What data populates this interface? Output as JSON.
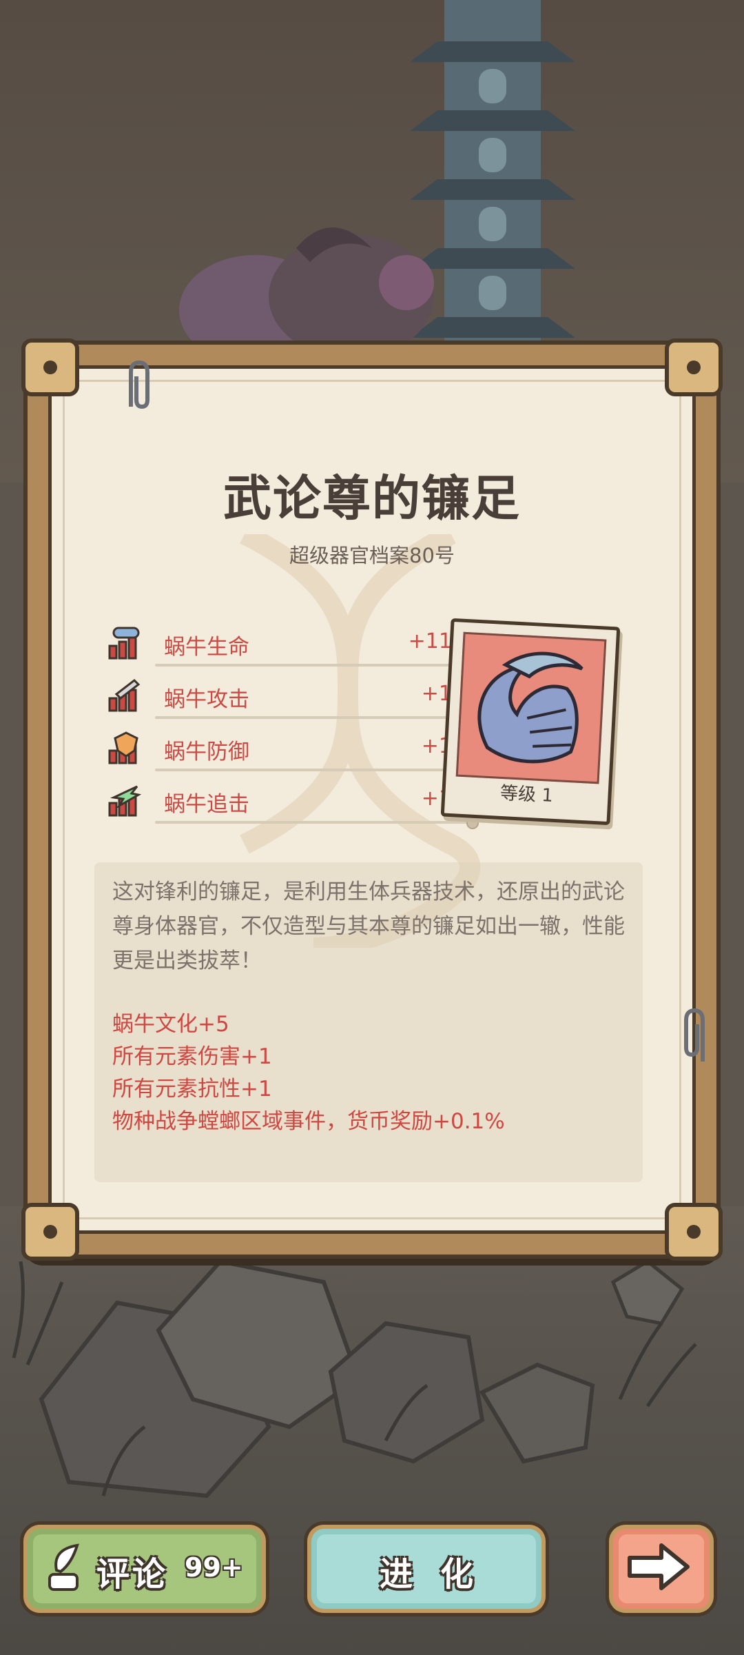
{
  "card": {
    "title": "武论尊的镰足",
    "subtitle": "超级器官档案80号",
    "level_text": "等级 1",
    "stats": [
      {
        "label": "蜗牛生命",
        "value": "+110",
        "icon": "snail-health-icon",
        "icon_color": "#8fb4dc"
      },
      {
        "label": "蜗牛攻击",
        "value": "+15",
        "icon": "snail-attack-icon",
        "icon_color": "#c9c9c9"
      },
      {
        "label": "蜗牛防御",
        "value": "+11",
        "icon": "snail-defense-icon",
        "icon_color": "#f0a65a"
      },
      {
        "label": "蜗牛追击",
        "value": "+15",
        "icon": "snail-pursuit-icon",
        "icon_color": "#8fdc9a"
      }
    ],
    "description": "这对锋利的镰足，是利用生体兵器技术，还原出的武论尊身体器官，不仅造型与其本尊的镰足如出一辙，性能更是出类拔萃！",
    "bonuses": [
      "蜗牛文化+5",
      "所有元素伤害+1",
      "所有元素抗性+1",
      "物种战争螳螂区域事件，货币奖励+0.1%"
    ]
  },
  "buttons": {
    "comment_label": "评论",
    "comment_count": "99+",
    "evolve_label": "进化",
    "next_icon": "arrow-right-icon"
  },
  "colors": {
    "stat_red": "#cc4a44",
    "paper": "#f3ecdc",
    "frame": "#b18a5b"
  }
}
